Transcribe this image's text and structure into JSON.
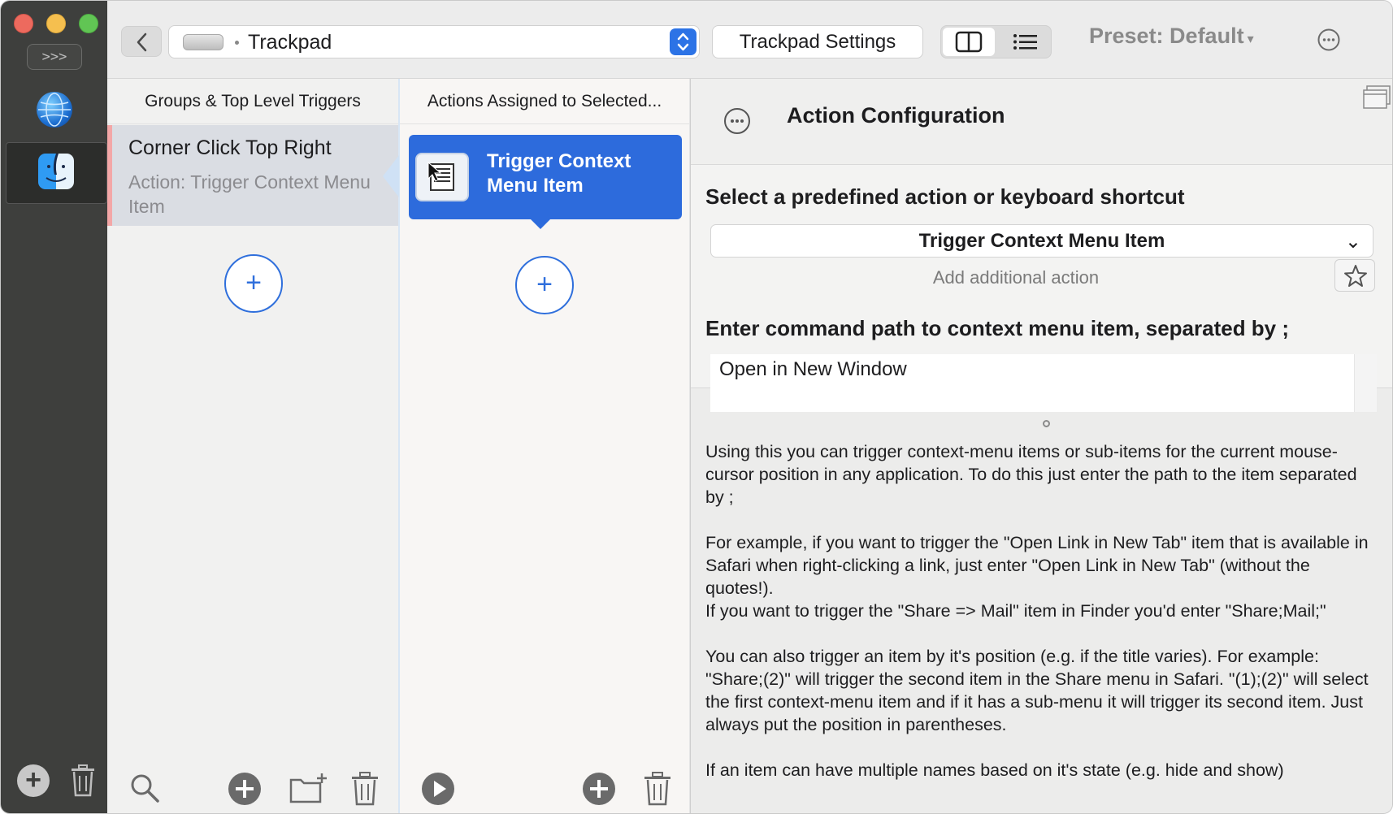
{
  "sidebar": {
    "expand_label": ">>>"
  },
  "toolbar": {
    "device_label": "Trackpad",
    "settings_label": "Trackpad Settings",
    "preset_label": "Preset: Default",
    "preset_caret": "▾"
  },
  "columns": {
    "groups_header": "Groups & Top Level Triggers",
    "actions_header": "Actions Assigned to Selected...",
    "trigger": {
      "title": "Corner Click Top Right",
      "subtitle": "Action: Trigger Context Menu Item"
    },
    "action": {
      "label": "Trigger Context Menu Item"
    },
    "add_symbol": "+"
  },
  "panel": {
    "title": "Action Configuration",
    "select_heading": "Select a predefined action or keyboard shortcut",
    "selected_action": "Trigger Context Menu Item",
    "select_chevron": "⌄",
    "add_additional": "Add additional action",
    "path_heading": "Enter command path to context menu item, separated by ;",
    "path_value": "Open in New Window",
    "help": [
      "Using this you can trigger context-menu items or sub-items for the current mouse-cursor position in any application. To do this just enter the path to the item separated by ;",
      "For example, if you want to trigger the \"Open Link in New Tab\" item that is available in Safari when right-clicking a link, just enter \"Open Link in New Tab\" (without the quotes!).\nIf you want to trigger the \"Share => Mail\" item in Finder you'd enter \"Share;Mail;\"",
      "You can also trigger an item by it's position (e.g. if the title varies). For example: \"Share;(2)\" will trigger the second item in the Share menu in Safari. \"(1);(2)\" will select the first context-menu item and if it has a sub-menu it will trigger its second item. Just always put the position in parentheses.",
      "If an item can have multiple names based on it's state (e.g. hide and show)"
    ]
  },
  "colors": {
    "accent": "#2d6bdc",
    "sidebar_bg": "#3e3f3d",
    "selected_row": "#dadde3"
  },
  "icons": [
    "back-chevron-icon",
    "trackpad-icon",
    "stepper-icon",
    "columns-view-icon",
    "list-view-icon",
    "more-icon",
    "globe-icon",
    "finder-icon",
    "add-icon",
    "trash-icon",
    "search-icon",
    "new-folder-icon",
    "play-icon",
    "window-icon",
    "star-icon",
    "context-menu-icon"
  ]
}
